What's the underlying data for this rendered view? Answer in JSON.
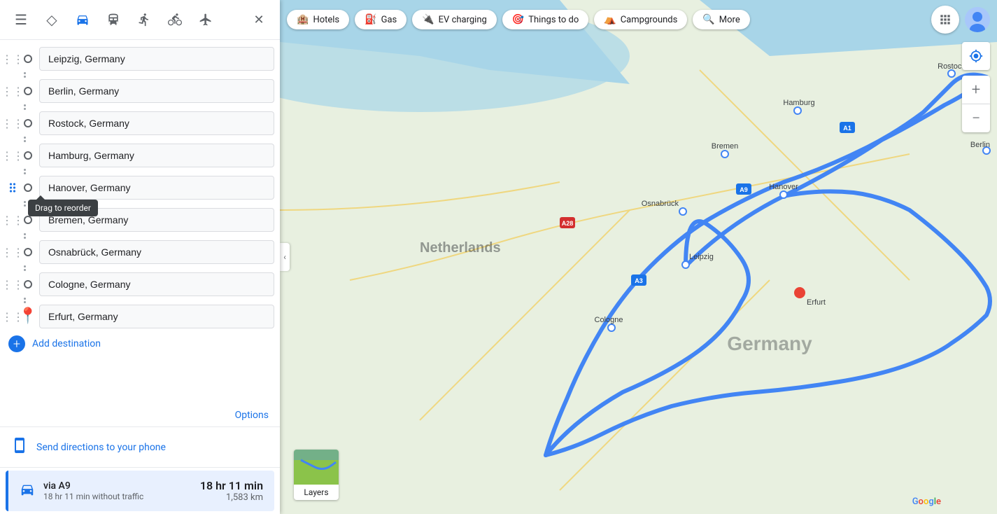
{
  "nav": {
    "icons": [
      {
        "name": "menu-icon",
        "symbol": "☰",
        "active": false
      },
      {
        "name": "search-icon",
        "symbol": "◇",
        "active": false
      },
      {
        "name": "driving-icon",
        "symbol": "🚗",
        "active": true
      },
      {
        "name": "transit-icon",
        "symbol": "🚌",
        "active": false
      },
      {
        "name": "walking-icon",
        "symbol": "🚶",
        "active": false
      },
      {
        "name": "cycling-icon",
        "symbol": "🚲",
        "active": false
      },
      {
        "name": "flight-icon",
        "symbol": "✈",
        "active": false
      }
    ],
    "close_label": "✕"
  },
  "waypoints": [
    {
      "id": 1,
      "value": "Leipzig, Germany",
      "type": "circle"
    },
    {
      "id": 2,
      "value": "Berlin, Germany",
      "type": "circle"
    },
    {
      "id": 3,
      "value": "Rostock, Germany",
      "type": "circle"
    },
    {
      "id": 4,
      "value": "Hamburg, Germany",
      "type": "circle"
    },
    {
      "id": 5,
      "value": "Hanover, Germany",
      "type": "circle"
    },
    {
      "id": 6,
      "value": "Bremen, Germany",
      "type": "circle"
    },
    {
      "id": 7,
      "value": "Osnabrück, Germany",
      "type": "circle"
    },
    {
      "id": 8,
      "value": "Cologne, Germany",
      "type": "circle"
    },
    {
      "id": 9,
      "value": "Erfurt, Germany",
      "type": "pin"
    }
  ],
  "drag_tooltip": "Drag to reorder",
  "add_destination_label": "Add destination",
  "options_label": "Options",
  "send_directions_label": "Send directions to your phone",
  "route": {
    "via": "via A9",
    "time": "18 hr 11 min",
    "distance": "1,583 km",
    "traffic": "18 hr 11 min without traffic"
  },
  "map_pills": [
    {
      "label": "Hotels",
      "icon": "🏨"
    },
    {
      "label": "Gas",
      "icon": "⛽"
    },
    {
      "label": "EV charging",
      "icon": "🔌"
    },
    {
      "label": "Things to do",
      "icon": "🎯"
    },
    {
      "label": "Campgrounds",
      "icon": "⛺"
    },
    {
      "label": "More",
      "icon": "🔍"
    }
  ],
  "layers_label": "Layers",
  "zoom_in_label": "+",
  "zoom_out_label": "−",
  "location_label": "⊕",
  "collapse_label": "‹"
}
